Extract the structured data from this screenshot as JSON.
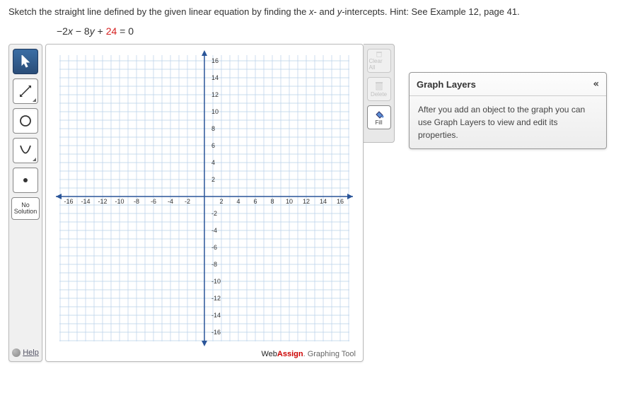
{
  "instructions": {
    "main_a": "Sketch the straight line defined by the given linear equation by finding the ",
    "xint": "x",
    "main_b": "- and ",
    "yint": "y",
    "main_c": "-intercepts. ",
    "hint": "Hint: See Example 12, page 41."
  },
  "equation": {
    "t1": "−2",
    "x": "x",
    "t2": " − 8",
    "y": "y",
    "t3": " + ",
    "c24": "24",
    "t4": " = 0"
  },
  "toolbox": {
    "no_solution": "No Solution",
    "help": "Help"
  },
  "side_buttons": {
    "clear_all": "Clear All",
    "delete": "Delete",
    "fill": "Fill"
  },
  "layers_panel": {
    "title": "Graph Layers",
    "collapse": "«",
    "body": "After you add an object to the graph you can use Graph Layers to view and edit its properties."
  },
  "brand": {
    "web": "Web",
    "assign": "Assign",
    "dot": ".",
    "tag": " Graphing Tool"
  },
  "axis": {
    "x_ticks": [
      -16,
      -14,
      -12,
      -10,
      -8,
      -6,
      -4,
      -2,
      2,
      4,
      6,
      8,
      10,
      12,
      14,
      16
    ],
    "y_ticks": [
      16,
      14,
      12,
      10,
      8,
      6,
      4,
      2,
      -2,
      -4,
      -6,
      -8,
      -10,
      -12,
      -14,
      -16
    ]
  }
}
